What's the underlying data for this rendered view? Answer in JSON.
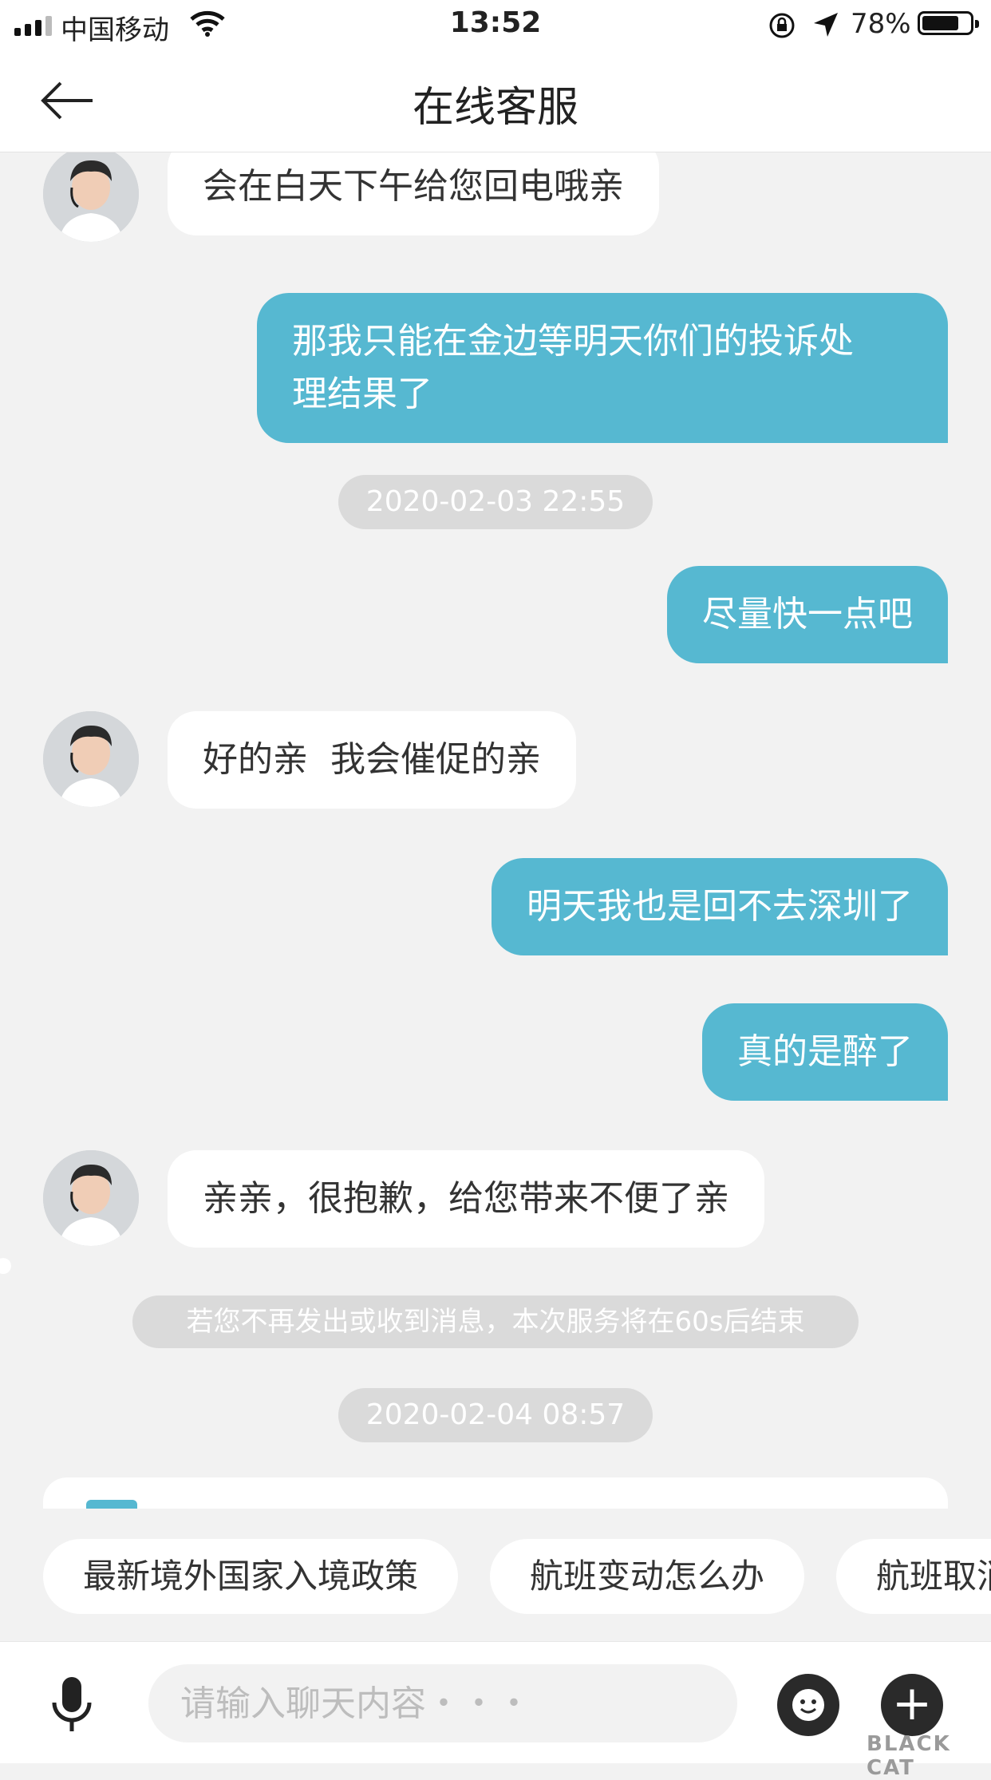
{
  "status_bar": {
    "carrier": "中国移动",
    "time": "13:52",
    "battery_text": "78%",
    "battery_level": 0.78,
    "signal_bars": 3
  },
  "nav": {
    "title": "在线客服"
  },
  "colors": {
    "outgoing_bubble": "#56b8d1",
    "incoming_bubble": "#ffffff",
    "background": "#f2f2f2",
    "pill": "#dadada"
  },
  "messages": [
    {
      "from": "agent",
      "text": "会在白天下午给您回电哦亲"
    },
    {
      "from": "user",
      "text": "那我只能在金边等明天你们的投诉处\n理结果了"
    },
    {
      "from": "timestamp",
      "text": "2020-02-03 22:55"
    },
    {
      "from": "user",
      "text": "尽量快一点吧"
    },
    {
      "from": "agent",
      "text": "好的亲  我会催促的亲"
    },
    {
      "from": "user",
      "text": "明天我也是回不去深圳了"
    },
    {
      "from": "user",
      "text": "真的是醉了"
    },
    {
      "from": "agent",
      "text": "亲亲，很抱歉，给您带来不便了亲"
    },
    {
      "from": "system",
      "text": "若您不再发出或收到消息，本次服务将在60s后结束"
    },
    {
      "from": "timestamp",
      "text": "2020-02-04 08:57"
    }
  ],
  "quick_replies": [
    "最新境外国家入境政策",
    "航班变动怎么办",
    "航班取消"
  ],
  "input": {
    "placeholder": "请输入聊天内容・・・"
  },
  "icons": [
    "back-arrow-icon",
    "wifi-icon",
    "lock-rotation-icon",
    "location-arrow-icon",
    "battery-icon",
    "microphone-icon",
    "emoji-icon",
    "plus-icon"
  ],
  "watermark": "BLACK CAT"
}
